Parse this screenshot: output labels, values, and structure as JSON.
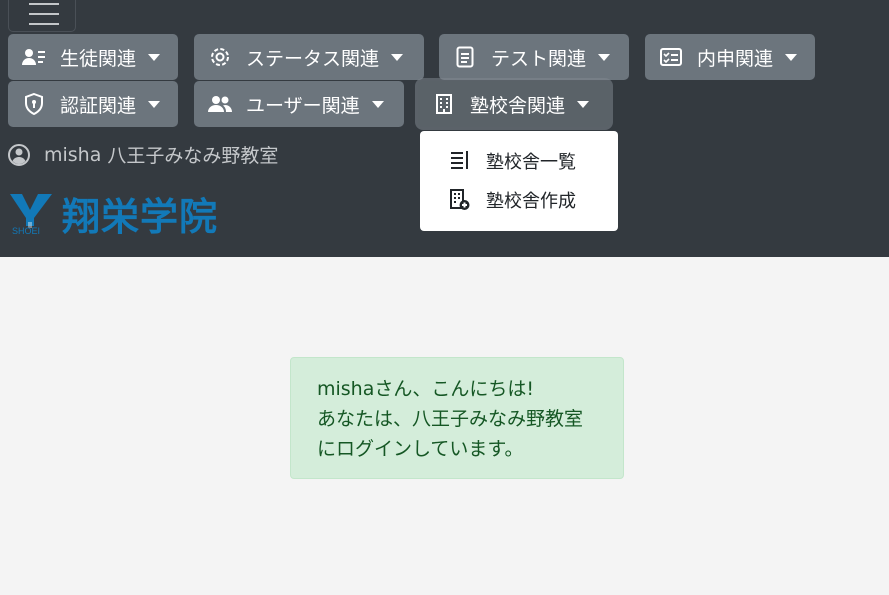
{
  "nav": {
    "menu_buttons": [
      {
        "label": "生徒関連",
        "icon": "student-card-icon"
      },
      {
        "label": "ステータス関連",
        "icon": "gear-icon"
      },
      {
        "label": "テスト関連",
        "icon": "document-icon"
      },
      {
        "label": "内申関連",
        "icon": "checklist-card-icon"
      },
      {
        "label": "認証関連",
        "icon": "shield-icon"
      },
      {
        "label": "ユーザー関連",
        "icon": "users-icon"
      },
      {
        "label": "塾校舎関連",
        "icon": "building-icon"
      }
    ]
  },
  "user": {
    "name": "misha",
    "school": "八王子みなみ野教室"
  },
  "logo": {
    "sub": "SHOEI",
    "name": "翔栄学院",
    "color": "#1279b8"
  },
  "dropdown": {
    "items": [
      {
        "label": "塾校舎一覧",
        "icon": "list-icon"
      },
      {
        "label": "塾校舎作成",
        "icon": "building-add-icon"
      }
    ]
  },
  "alert": {
    "lines": [
      "mishaさん、こんにちは!",
      "あなたは、八王子みなみ野教室",
      "にログインしています。"
    ]
  },
  "colors": {
    "header_bg": "#343a40",
    "button_bg": "#6c757d",
    "alert_bg": "#d4edda",
    "alert_text": "#155724",
    "page_bg": "#f4f4f4"
  }
}
